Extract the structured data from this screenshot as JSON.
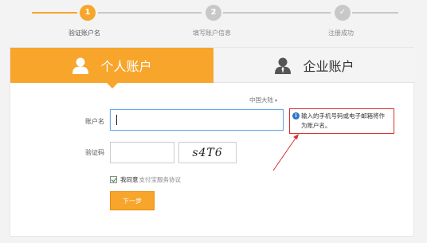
{
  "steps": [
    {
      "number": "1",
      "label": "验证账户名"
    },
    {
      "number": "2",
      "label": "填写账户信息"
    },
    {
      "number": "✓",
      "label": "注册成功"
    }
  ],
  "tabs": {
    "personal": "个人账户",
    "enterprise": "企业账户"
  },
  "form": {
    "region": "中国大陆",
    "account_label": "账户名",
    "account_value": "",
    "code_label": "验证码",
    "code_value": "",
    "captcha_text": "s4T6",
    "agree_text": "我同意",
    "agree_link": "支付宝服务协议",
    "agree_checked": true,
    "next_button": "下一步"
  },
  "tooltip": {
    "icon": "info-icon",
    "text": "输入的手机号码或电子邮箱将作为账户名。"
  },
  "colors": {
    "accent": "#f7a52b",
    "inactive": "#c8c8c8",
    "tooltip_border": "#d83030"
  }
}
